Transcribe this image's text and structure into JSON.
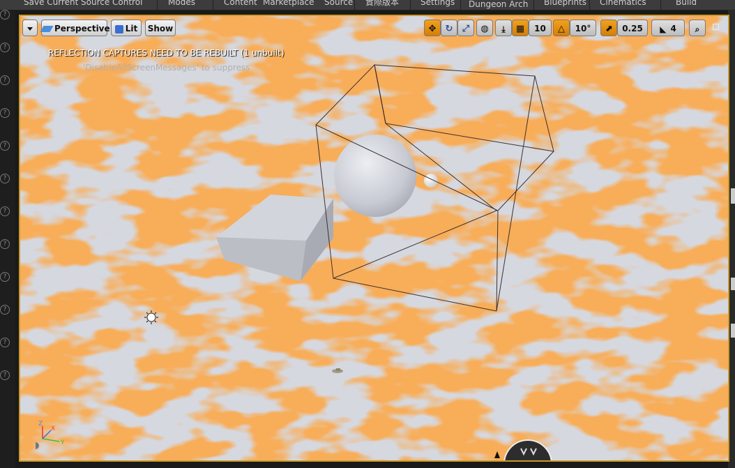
{
  "top_toolbar": {
    "items": [
      "Save Current",
      "Source Control",
      "Modes",
      "Content",
      "Marketplace",
      "Source",
      "實際版本",
      "Settings",
      "Dungeon Arch",
      "Blueprints",
      "Cinematics",
      "Build"
    ]
  },
  "viewport_toolbar": {
    "menu_icon": "chevron-down-icon",
    "perspective_label": "Perspective",
    "lit_label": "Lit",
    "show_label": "Show",
    "grid_snap_value": "10",
    "rotation_snap_value": "10°",
    "scale_snap_value": "0.25",
    "camera_speed_value": "4"
  },
  "messages": {
    "warning": "REFLECTION CAPTURES NEED TO BE REBUILT (1 unbuilt)",
    "hint": "'DisableAllScreenMessages' to suppress"
  },
  "axis_labels": {
    "x": "X",
    "y": "Y",
    "z": "Z"
  },
  "colors": {
    "viewport_border": "#c89a2a",
    "lava": "#f07a22",
    "ground": "#d6d8e0",
    "snap_active": "#f2a11d"
  }
}
